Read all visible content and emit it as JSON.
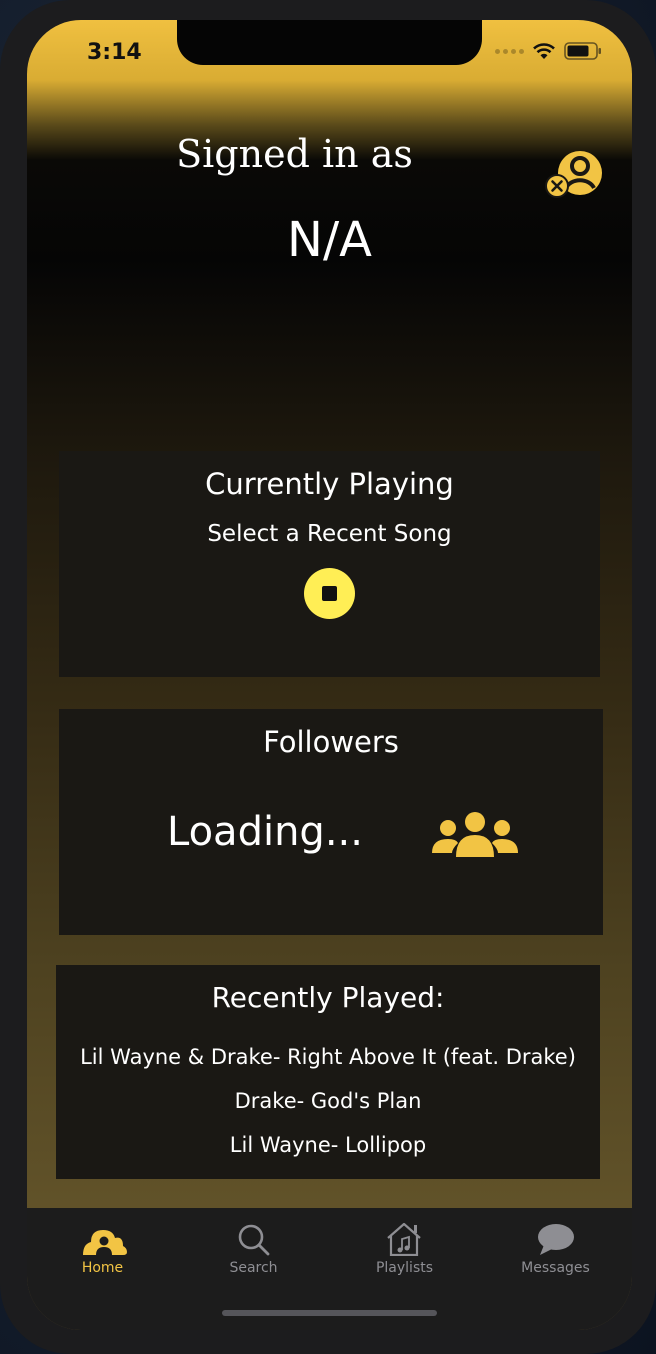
{
  "status_bar": {
    "time": "3:14"
  },
  "header": {
    "signed_in_label": "Signed in as",
    "username": "N/A"
  },
  "currently_playing": {
    "heading": "Currently Playing",
    "subtitle": "Select a Recent Song"
  },
  "followers": {
    "heading": "Followers",
    "value": "Loading..."
  },
  "recently_played": {
    "heading": "Recently Played:",
    "tracks": [
      "Lil Wayne & Drake- Right Above It (feat. Drake)",
      "Drake- God's Plan",
      "Lil Wayne- Lollipop"
    ]
  },
  "tabs": [
    {
      "label": "Home",
      "icon": "home-cloud-icon"
    },
    {
      "label": "Search",
      "icon": "search-icon"
    },
    {
      "label": "Playlists",
      "icon": "playlist-house-icon"
    },
    {
      "label": "Messages",
      "icon": "chat-bubble-icon"
    }
  ],
  "colors": {
    "accent": "#f2c444",
    "stop_button": "#ffee55",
    "card_bg": "#1a1814",
    "tabbar_bg": "#1c1c1c"
  }
}
